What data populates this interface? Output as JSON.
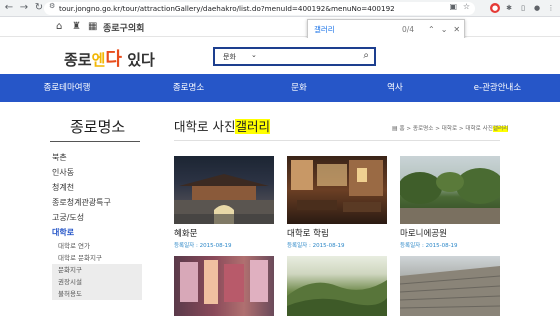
{
  "browser": {
    "url": "tour.jongno.go.kr/tour/attractionGallery/daehakro/list.do?menuId=400192&menuNo=400192"
  },
  "find": {
    "query": "갤러리",
    "count": "0/4"
  },
  "topbar": {
    "uni_label": "종로구의회"
  },
  "header": {
    "logo_part1": "종로",
    "logo_part2": "엔",
    "logo_part3": "다",
    "logo_part4": " 있다",
    "search_value": "문화"
  },
  "gnb": [
    "종로테마여행",
    "종로명소",
    "문화",
    "역사",
    "e-관광안내소"
  ],
  "side": {
    "title": "종로명소",
    "items": [
      "북촌",
      "인사동",
      "청계천",
      "종로청계관광특구",
      "고궁/도성",
      "대학로"
    ],
    "subs": [
      "대학로 연가",
      "대학로 문화지구"
    ],
    "subs2": [
      "문화지구",
      "권장시설",
      "불허용도"
    ]
  },
  "page": {
    "title_prefix": "대학로 사진",
    "title_hl": "갤러리",
    "breadcrumb": "홈 > 종로명소 > 대학로 > 대학로 사진",
    "breadcrumb_hl": "갤러리"
  },
  "cards": [
    {
      "name": "혜화문",
      "date": "등록일자 : 2015-08-19"
    },
    {
      "name": "대학로 학림",
      "date": "등록일자 : 2015-08-19"
    },
    {
      "name": "마로니에공원",
      "date": "등록일자 : 2015-08-19"
    }
  ],
  "icons": [
    "back-icon",
    "forward-icon",
    "reload-icon",
    "home-icon",
    "search-icon",
    "chevron-down-icon",
    "close-icon",
    "print-icon"
  ]
}
